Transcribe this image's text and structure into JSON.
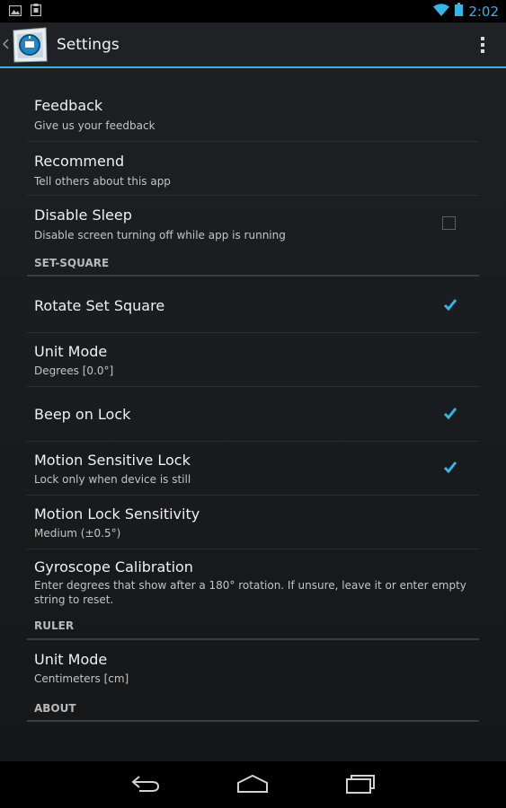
{
  "status_bar": {
    "time": "2:02",
    "left_icons": [
      "image-icon",
      "clipboard-icon"
    ],
    "right_icons": [
      "wifi-icon",
      "battery-icon"
    ]
  },
  "action_bar": {
    "title": "Settings",
    "back_icon": "chevron-left-icon",
    "logo_icon": "app-logo-icon",
    "overflow_icon": "overflow-menu-icon"
  },
  "settings": {
    "feedback": {
      "title": "Feedback",
      "summary": "Give us your feedback"
    },
    "recommend": {
      "title": "Recommend",
      "summary": "Tell others about this app"
    },
    "disable_sleep": {
      "title": "Disable Sleep",
      "summary": "Disable screen turning off while app is running",
      "checked": false
    },
    "set_square_header": "SET-SQUARE",
    "rotate": {
      "title": "Rotate Set Square",
      "checked": true
    },
    "unit_mode_sq": {
      "title": "Unit Mode",
      "summary": "Degrees [0.0°]"
    },
    "beep": {
      "title": "Beep on Lock",
      "checked": true
    },
    "motion_lock": {
      "title": "Motion Sensitive Lock",
      "summary": "Lock only when device is still",
      "checked": true
    },
    "motion_sens": {
      "title": "Motion Lock Sensitivity",
      "summary": "Medium (±0.5°)"
    },
    "gyro": {
      "title": "Gyroscope Calibration",
      "summary": "Enter degrees that show after a 180° rotation. If unsure, leave it or enter empty string to reset."
    },
    "ruler_header": "RULER",
    "unit_mode_ruler": {
      "title": "Unit Mode",
      "summary": "Centimeters [cm]"
    },
    "about_header": "ABOUT"
  },
  "nav_bar": {
    "buttons": [
      "back-icon",
      "home-icon",
      "recents-icon"
    ]
  },
  "colors": {
    "accent": "#33b5e5",
    "background": "#17191b",
    "text_primary": "#f0f0f0",
    "text_secondary": "#c4c4c4"
  }
}
